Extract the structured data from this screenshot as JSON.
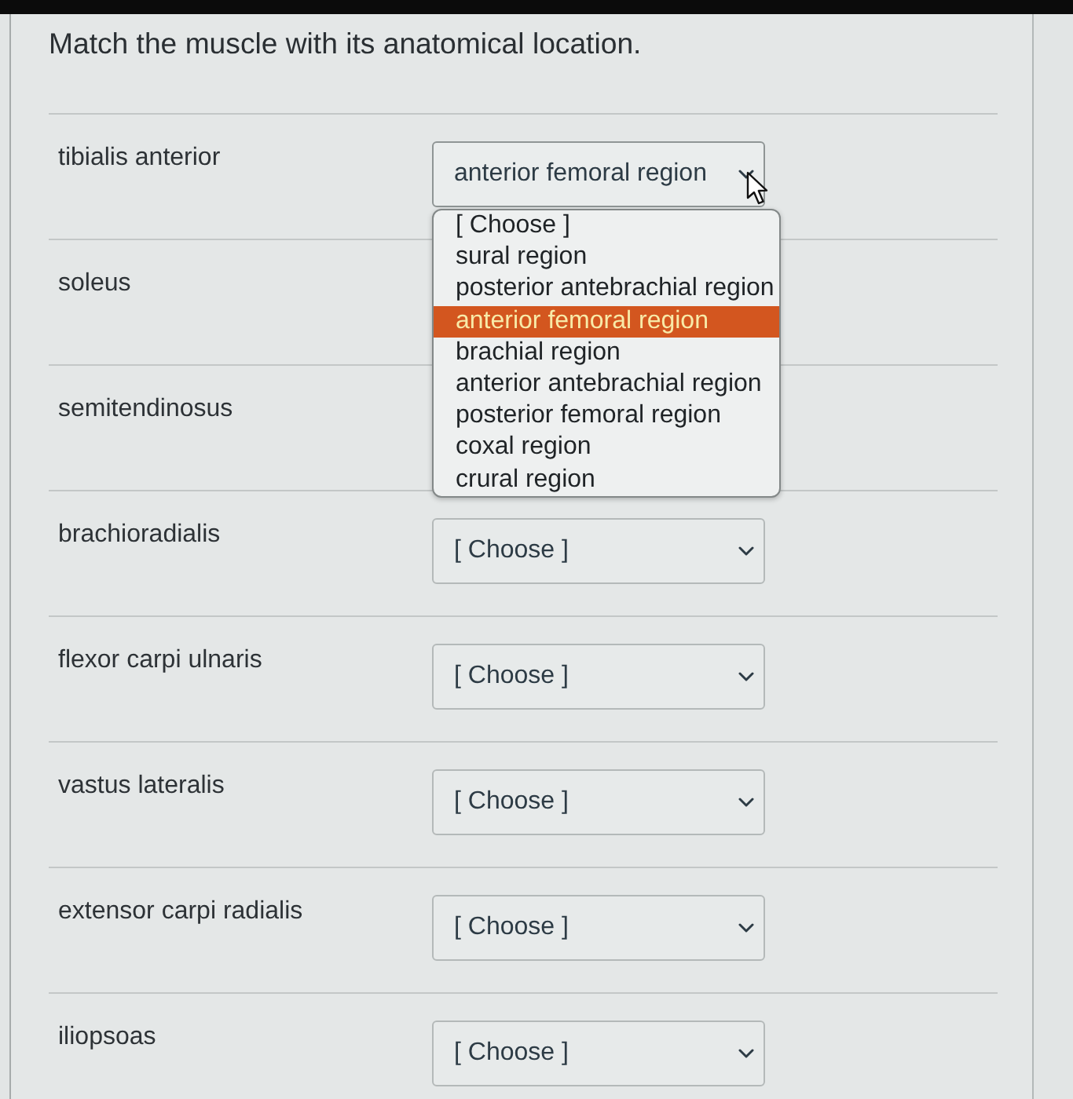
{
  "question": {
    "prompt": "Match the muscle with its anatomical location."
  },
  "rows": [
    {
      "term": "tibialis anterior",
      "select": {
        "value": "anterior femoral region",
        "expanded": true,
        "options": [
          {
            "label": "[ Choose ]",
            "selected": false
          },
          {
            "label": "sural region",
            "selected": false
          },
          {
            "label": "posterior antebrachial region",
            "selected": false
          },
          {
            "label": "anterior femoral region",
            "selected": true
          },
          {
            "label": "brachial region",
            "selected": false
          },
          {
            "label": "anterior antebrachial region",
            "selected": false
          },
          {
            "label": "posterior femoral region",
            "selected": false
          },
          {
            "label": "coxal region",
            "selected": false
          },
          {
            "label": "crural region",
            "selected": false
          }
        ]
      }
    },
    {
      "term": "soleus"
    },
    {
      "term": "semitendinosus"
    },
    {
      "term": "brachioradialis",
      "select": {
        "value": "[ Choose ]",
        "expanded": false
      }
    },
    {
      "term": "flexor carpi ulnaris",
      "select": {
        "value": "[ Choose ]",
        "expanded": false
      }
    },
    {
      "term": "vastus lateralis",
      "select": {
        "value": "[ Choose ]",
        "expanded": false
      }
    },
    {
      "term": "extensor carpi radialis",
      "select": {
        "value": "[ Choose ]",
        "expanded": false
      }
    },
    {
      "term": "iliopsoas",
      "select": {
        "value": "[ Choose ]",
        "expanded": false
      }
    }
  ]
}
